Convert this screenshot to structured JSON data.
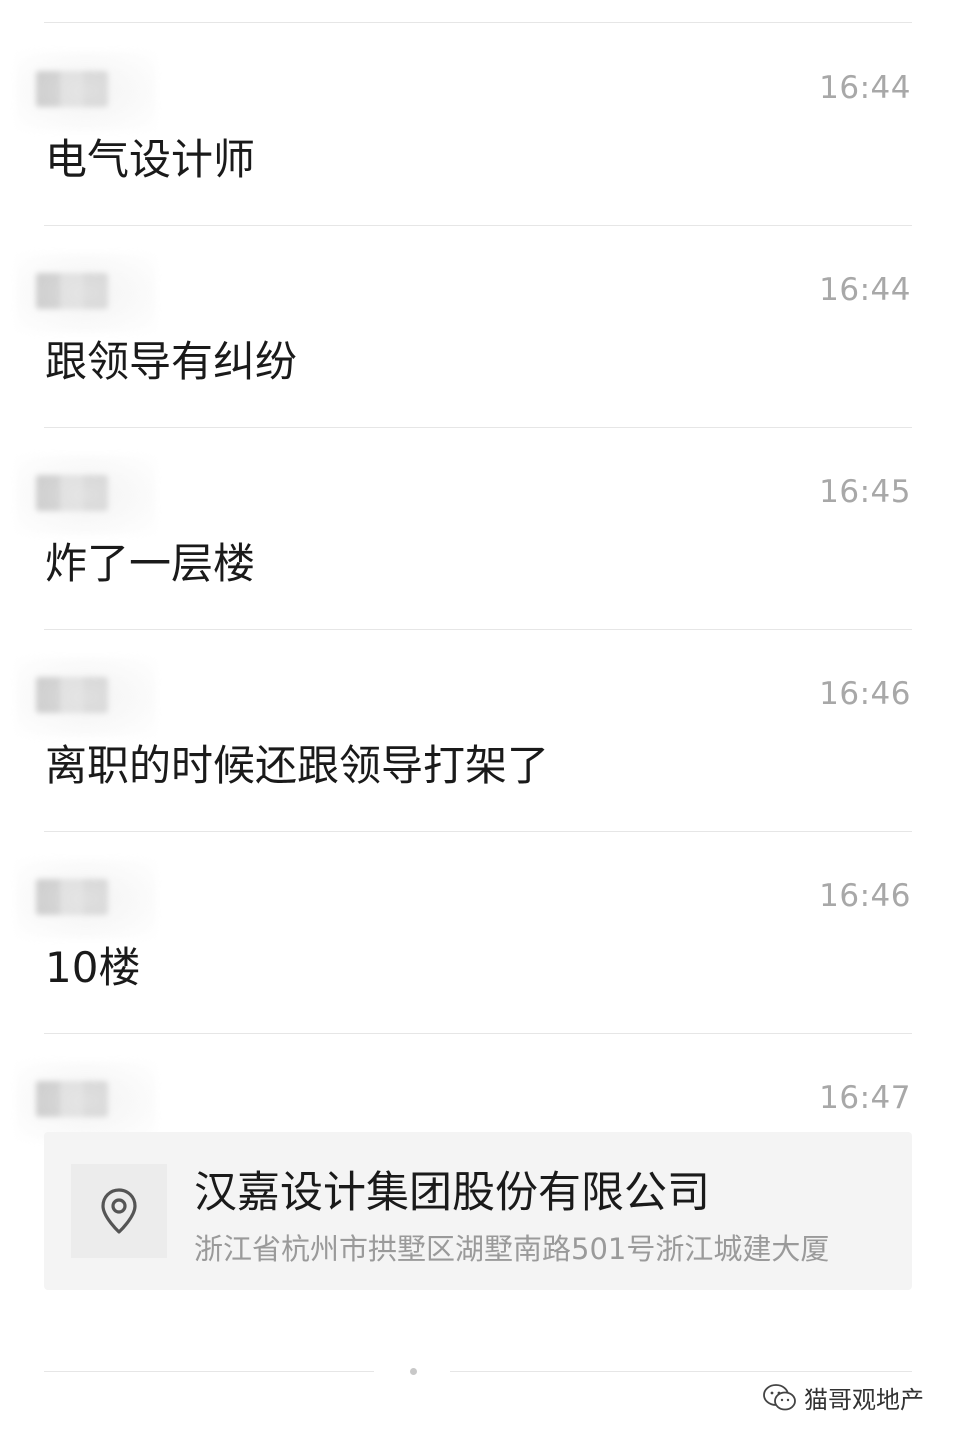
{
  "messages": [
    {
      "time": "16:44",
      "text": "电气设计师"
    },
    {
      "time": "16:44",
      "text": "跟领导有纠纷"
    },
    {
      "time": "16:45",
      "text": "炸了一层楼"
    },
    {
      "time": "16:46",
      "text": "离职的时候还跟领导打架了"
    },
    {
      "time": "16:46",
      "text": "10楼"
    },
    {
      "time": "16:47",
      "text": ""
    }
  ],
  "location_card": {
    "icon": "map-pin-icon",
    "title": "汉嘉设计集团股份有限公司",
    "address": "浙江省杭州市拱墅区湖墅南路501号浙江城建大厦"
  },
  "watermark": {
    "icon": "wechat-icon",
    "text": "猫哥观地产"
  },
  "colors": {
    "time": "#a8a8a8",
    "text": "#1a1a1a",
    "card_bg": "#f4f4f4",
    "address": "#9a9a9a",
    "divider": "#e6e6e6"
  }
}
